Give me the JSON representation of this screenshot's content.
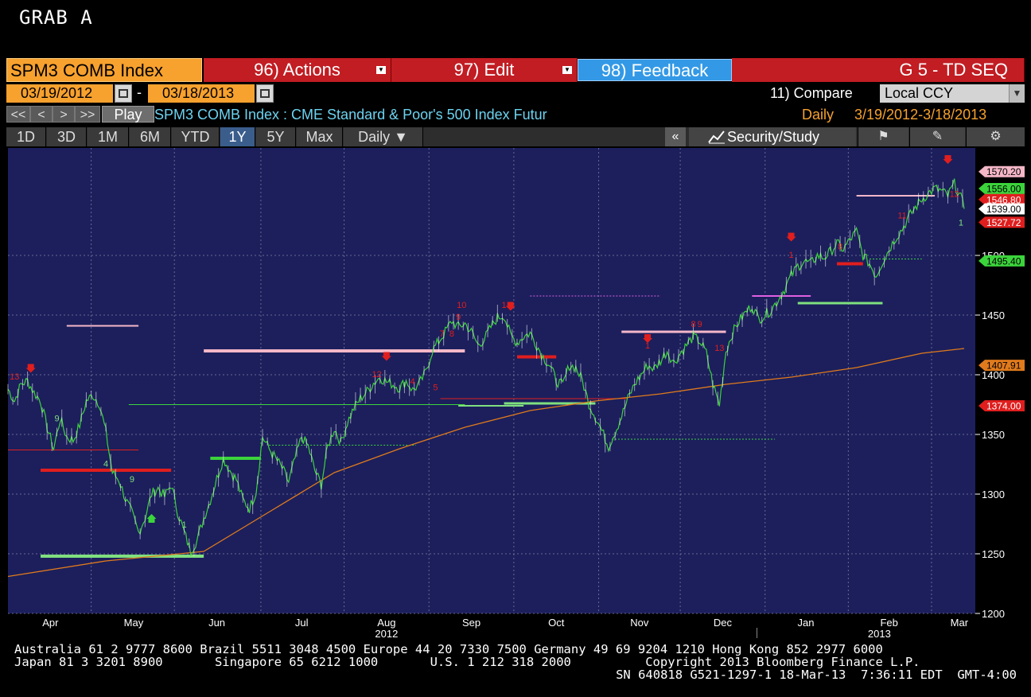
{
  "grab_title": "GRAB A",
  "toolbar": {
    "security": "SPM3 COMB Index",
    "actions": "96) Actions",
    "edit": "97) Edit",
    "feedback": "98) Feedback",
    "function_title": "G 5 - TD SEQ"
  },
  "dates": {
    "start": "03/19/2012",
    "separator": "-",
    "end": "03/18/2013",
    "compare_label": "11) Compare",
    "currency": "Local CCY"
  },
  "nav": {
    "buttons": [
      "<<",
      "<",
      ">",
      ">>"
    ],
    "play": "Play",
    "description": "SPM3 COMB Index : CME Standard & Poor's 500 Index Futur",
    "frequency": "Daily",
    "range": "3/19/2012-3/18/2013"
  },
  "periods": [
    "1D",
    "3D",
    "1M",
    "6M",
    "YTD",
    "1Y",
    "5Y",
    "Max",
    "Daily ▼"
  ],
  "active_period": "1Y",
  "study_button": "Security/Study",
  "colors": {
    "chart_bg": "#1c1f5c",
    "price": "#3bd43b",
    "moving_average": "#e07a1c",
    "sell_setup": "#e01e1e",
    "buy_setup": "#7fe07f",
    "pink": "#f4b7c8",
    "accent_orange": "#f7a12e",
    "red_button": "#c11d23",
    "blue_button": "#3399e6"
  },
  "chart_data": {
    "type": "line",
    "title": "",
    "xlabel": "",
    "ylabel": "",
    "ylim": [
      1200,
      1590
    ],
    "yticks": [
      1200,
      1250,
      1300,
      1350,
      1400,
      1450,
      1500
    ],
    "grid": true,
    "x_month_labels": [
      "Apr",
      "May",
      "Jun",
      "Jul",
      "Aug",
      "Sep",
      "Oct",
      "Nov",
      "Dec",
      "Jan",
      "Feb",
      "Mar"
    ],
    "year_labels": [
      "2012",
      "2013"
    ],
    "series": [
      {
        "values": [
          [
            0,
            1388
          ],
          [
            4,
            1378
          ],
          [
            8,
            1392
          ],
          [
            12,
            1395
          ],
          [
            16,
            1385
          ],
          [
            20,
            1378
          ],
          [
            24,
            1356
          ],
          [
            28,
            1338
          ],
          [
            32,
            1363
          ],
          [
            36,
            1348
          ],
          [
            40,
            1345
          ],
          [
            44,
            1358
          ],
          [
            48,
            1378
          ],
          [
            52,
            1383
          ],
          [
            56,
            1376
          ],
          [
            60,
            1352
          ],
          [
            64,
            1318
          ],
          [
            68,
            1312
          ],
          [
            72,
            1296
          ],
          [
            76,
            1284
          ],
          [
            80,
            1268
          ],
          [
            84,
            1280
          ],
          [
            88,
            1300
          ],
          [
            92,
            1305
          ],
          [
            96,
            1298
          ],
          [
            100,
            1308
          ],
          [
            104,
            1285
          ],
          [
            108,
            1268
          ],
          [
            112,
            1252
          ],
          [
            116,
            1262
          ],
          [
            120,
            1280
          ],
          [
            124,
            1295
          ],
          [
            128,
            1313
          ],
          [
            132,
            1330
          ],
          [
            136,
            1320
          ],
          [
            140,
            1312
          ],
          [
            144,
            1295
          ],
          [
            148,
            1288
          ],
          [
            152,
            1302
          ],
          [
            156,
            1348
          ],
          [
            160,
            1338
          ],
          [
            164,
            1330
          ],
          [
            168,
            1322
          ],
          [
            172,
            1310
          ],
          [
            176,
            1330
          ],
          [
            180,
            1348
          ],
          [
            184,
            1340
          ],
          [
            188,
            1320
          ],
          [
            192,
            1308
          ],
          [
            196,
            1340
          ],
          [
            200,
            1355
          ],
          [
            204,
            1343
          ],
          [
            208,
            1360
          ],
          [
            212,
            1372
          ],
          [
            216,
            1380
          ],
          [
            220,
            1386
          ],
          [
            224,
            1393
          ],
          [
            228,
            1398
          ],
          [
            232,
            1394
          ],
          [
            236,
            1392
          ],
          [
            240,
            1389
          ],
          [
            244,
            1395
          ],
          [
            248,
            1387
          ],
          [
            252,
            1392
          ],
          [
            256,
            1402
          ],
          [
            260,
            1420
          ],
          [
            264,
            1428
          ],
          [
            268,
            1436
          ],
          [
            272,
            1445
          ],
          [
            276,
            1440
          ],
          [
            280,
            1443
          ],
          [
            284,
            1436
          ],
          [
            288,
            1425
          ],
          [
            292,
            1430
          ],
          [
            296,
            1440
          ],
          [
            300,
            1448
          ],
          [
            304,
            1450
          ],
          [
            308,
            1433
          ],
          [
            312,
            1427
          ],
          [
            316,
            1432
          ],
          [
            320,
            1435
          ],
          [
            324,
            1425
          ],
          [
            328,
            1415
          ],
          [
            332,
            1408
          ],
          [
            336,
            1395
          ],
          [
            340,
            1391
          ],
          [
            344,
            1408
          ],
          [
            348,
            1406
          ],
          [
            352,
            1395
          ],
          [
            356,
            1376
          ],
          [
            360,
            1365
          ],
          [
            364,
            1353
          ],
          [
            368,
            1340
          ],
          [
            372,
            1352
          ],
          [
            376,
            1365
          ],
          [
            380,
            1380
          ],
          [
            384,
            1392
          ],
          [
            388,
            1400
          ],
          [
            392,
            1408
          ],
          [
            396,
            1405
          ],
          [
            400,
            1412
          ],
          [
            404,
            1420
          ],
          [
            408,
            1410
          ],
          [
            412,
            1418
          ],
          [
            416,
            1425
          ],
          [
            420,
            1432
          ],
          [
            424,
            1428
          ],
          [
            428,
            1418
          ],
          [
            432,
            1392
          ],
          [
            436,
            1375
          ],
          [
            440,
            1420
          ],
          [
            444,
            1435
          ],
          [
            448,
            1445
          ],
          [
            452,
            1452
          ],
          [
            456,
            1458
          ],
          [
            460,
            1447
          ],
          [
            464,
            1450
          ],
          [
            468,
            1455
          ],
          [
            472,
            1463
          ],
          [
            476,
            1472
          ],
          [
            480,
            1483
          ],
          [
            484,
            1491
          ],
          [
            488,
            1495
          ],
          [
            492,
            1493
          ],
          [
            496,
            1500
          ],
          [
            500,
            1498
          ],
          [
            504,
            1503
          ],
          [
            508,
            1510
          ],
          [
            512,
            1505
          ],
          [
            516,
            1513
          ],
          [
            520,
            1520
          ],
          [
            524,
            1500
          ],
          [
            528,
            1493
          ],
          [
            532,
            1483
          ],
          [
            536,
            1495
          ],
          [
            540,
            1505
          ],
          [
            544,
            1515
          ],
          [
            548,
            1522
          ],
          [
            552,
            1532
          ],
          [
            556,
            1540
          ],
          [
            560,
            1547
          ],
          [
            564,
            1552
          ],
          [
            568,
            1556
          ],
          [
            572,
            1554
          ],
          [
            576,
            1550
          ],
          [
            580,
            1560
          ],
          [
            584,
            1548
          ],
          [
            586,
            1539
          ]
        ],
        "y_value_pairs": true
      },
      {
        "values": [
          [
            0,
            1231
          ],
          [
            60,
            1244
          ],
          [
            120,
            1252
          ],
          [
            160,
            1285
          ],
          [
            200,
            1318
          ],
          [
            240,
            1338
          ],
          [
            280,
            1356
          ],
          [
            320,
            1370
          ],
          [
            360,
            1378
          ],
          [
            400,
            1384
          ],
          [
            440,
            1392
          ],
          [
            480,
            1398
          ],
          [
            520,
            1406
          ],
          [
            560,
            1418
          ],
          [
            586,
            1422
          ]
        ],
        "y_value_pairs": true
      }
    ],
    "price_tags": [
      {
        "label": "1570.20",
        "value": 1570.2,
        "color": "#f4b7c8",
        "text_color": "#000"
      },
      {
        "label": "1556.00",
        "value": 1556.0,
        "color": "#3bd43b",
        "text_color": "#000"
      },
      {
        "label": "1546.80",
        "value": 1546.8,
        "color": "#e01e1e",
        "text_color": "#fff"
      },
      {
        "label": "1539.00",
        "value": 1539.0,
        "color": "#ffffff",
        "text_color": "#000"
      },
      {
        "label": "1527.72",
        "value": 1527.72,
        "color": "#e01e1e",
        "text_color": "#fff"
      },
      {
        "label": "1495.40",
        "value": 1495.4,
        "color": "#3bd43b",
        "text_color": "#000"
      },
      {
        "label": "1407.91",
        "value": 1407.91,
        "color": "#e07a1c",
        "text_color": "#000"
      },
      {
        "label": "1374.00",
        "value": 1374.0,
        "color": "#e01e1e",
        "text_color": "#fff"
      }
    ],
    "tdst_levels": [
      {
        "x0": 20,
        "x1": 100,
        "value": 1320,
        "color": "#e01e1e",
        "width": 4
      },
      {
        "x0": 20,
        "x1": 120,
        "value": 1248,
        "color": "#7fe07f",
        "width": 4
      },
      {
        "x0": 124,
        "x1": 155,
        "value": 1330,
        "color": "#3bd43b",
        "width": 4
      },
      {
        "x0": 120,
        "x1": 280,
        "value": 1420,
        "color": "#f4b7c8",
        "width": 4
      },
      {
        "x0": 36,
        "x1": 80,
        "value": 1441,
        "color": "#f4b7c8",
        "width": 2
      },
      {
        "x0": 74,
        "x1": 280,
        "value": 1375,
        "color": "#3bd43b",
        "width": 1
      },
      {
        "x0": 0,
        "x1": 80,
        "value": 1337,
        "color": "#e01e1e",
        "width": 1
      },
      {
        "x0": 160,
        "x1": 250,
        "value": 1341,
        "color": "#3bd43b",
        "width": 1,
        "dashed": true
      },
      {
        "x0": 265,
        "x1": 380,
        "value": 1380,
        "color": "#e01e1e",
        "width": 1
      },
      {
        "x0": 304,
        "x1": 360,
        "value": 1376,
        "color": "#7fe07f",
        "width": 3
      },
      {
        "x0": 320,
        "x1": 400,
        "value": 1466,
        "color": "#e060e0",
        "width": 1,
        "dashed": true
      },
      {
        "x0": 376,
        "x1": 440,
        "value": 1436,
        "color": "#f4b7c8",
        "width": 3
      },
      {
        "x0": 370,
        "x1": 470,
        "value": 1346,
        "color": "#3bd43b",
        "width": 1,
        "dashed": true
      },
      {
        "x0": 312,
        "x1": 336,
        "value": 1415,
        "color": "#e01e1e",
        "width": 4
      },
      {
        "x0": 276,
        "x1": 316,
        "value": 1374,
        "color": "#7fe07f",
        "width": 2
      },
      {
        "x0": 456,
        "x1": 492,
        "value": 1466,
        "color": "#e060e0",
        "width": 2
      },
      {
        "x0": 484,
        "x1": 536,
        "value": 1460,
        "color": "#7fe07f",
        "width": 3
      },
      {
        "x0": 508,
        "x1": 524,
        "value": 1493,
        "color": "#e01e1e",
        "width": 4
      },
      {
        "x0": 520,
        "x1": 568,
        "value": 1550,
        "color": "#f4b7c8",
        "width": 2
      },
      {
        "x0": 528,
        "x1": 560,
        "value": 1497,
        "color": "#3bd43b",
        "width": 1,
        "dashed": true
      }
    ],
    "setup_counts": [
      {
        "x": 30,
        "value": 1361,
        "text": "9",
        "color": "#7fe07f"
      },
      {
        "x": 4,
        "value": 1396,
        "text": "13",
        "color": "#e01e1e"
      },
      {
        "x": 60,
        "value": 1323,
        "text": "4",
        "color": "#7fe07f"
      },
      {
        "x": 76,
        "value": 1310,
        "text": "9",
        "color": "#7fe07f"
      },
      {
        "x": 108,
        "value": 1272,
        "text": "1",
        "color": "#7fe07f"
      },
      {
        "x": 226,
        "value": 1398,
        "text": "12",
        "color": "#e01e1e"
      },
      {
        "x": 248,
        "value": 1392,
        "text": "4",
        "color": "#e01e1e"
      },
      {
        "x": 262,
        "value": 1387,
        "text": "5",
        "color": "#e01e1e"
      },
      {
        "x": 278,
        "value": 1456,
        "text": "10",
        "color": "#e01e1e"
      },
      {
        "x": 276,
        "value": 1446,
        "text": "9",
        "color": "#e01e1e"
      },
      {
        "x": 272,
        "value": 1432,
        "text": "8",
        "color": "#e01e1e"
      },
      {
        "x": 266,
        "value": 1432,
        "text": "7",
        "color": "#e01e1e"
      },
      {
        "x": 392,
        "value": 1422,
        "text": "1",
        "color": "#e01e1e"
      },
      {
        "x": 420,
        "value": 1440,
        "text": "8",
        "color": "#e01e1e"
      },
      {
        "x": 424,
        "value": 1440,
        "text": "9",
        "color": "#e01e1e"
      },
      {
        "x": 436,
        "value": 1420,
        "text": "13",
        "color": "#e01e1e"
      },
      {
        "x": 480,
        "value": 1498,
        "text": "1",
        "color": "#e01e1e"
      },
      {
        "x": 510,
        "value": 1505,
        "text": "8",
        "color": "#e01e1e"
      },
      {
        "x": 548,
        "value": 1531,
        "text": "11",
        "color": "#e01e1e"
      },
      {
        "x": 580,
        "value": 1549,
        "text": "12",
        "color": "#e01e1e"
      },
      {
        "x": 584,
        "value": 1525,
        "text": "1",
        "color": "#7fe07f"
      },
      {
        "x": 304,
        "value": 1456,
        "text": "1",
        "color": "#e01e1e"
      }
    ],
    "arrows": [
      {
        "x": 14,
        "value": 1405,
        "color": "#e01e1e",
        "direction": "down"
      },
      {
        "x": 232,
        "value": 1415,
        "color": "#e01e1e",
        "direction": "down"
      },
      {
        "x": 308,
        "value": 1457,
        "color": "#e01e1e",
        "direction": "down"
      },
      {
        "x": 392,
        "value": 1430,
        "color": "#e01e1e",
        "direction": "down"
      },
      {
        "x": 480,
        "value": 1515,
        "color": "#e01e1e",
        "direction": "down"
      },
      {
        "x": 576,
        "value": 1580,
        "color": "#e01e1e",
        "direction": "down"
      },
      {
        "x": 88,
        "value": 1280,
        "color": "#3bd43b",
        "direction": "up"
      }
    ]
  },
  "footer": {
    "line1": "Australia 61 2 9777 8600 Brazil 5511 3048 4500 Europe 44 20 7330 7500 Germany 49 69 9204 1210 Hong Kong 852 2977 6000",
    "line2": "Japan 81 3 3201 8900       Singapore 65 6212 1000       U.S. 1 212 318 2000          Copyright 2013 Bloomberg Finance L.P.",
    "line3": "SN 640818 G521-1297-1 18-Mar-13  7:36:11 EDT  GMT-4:00"
  }
}
